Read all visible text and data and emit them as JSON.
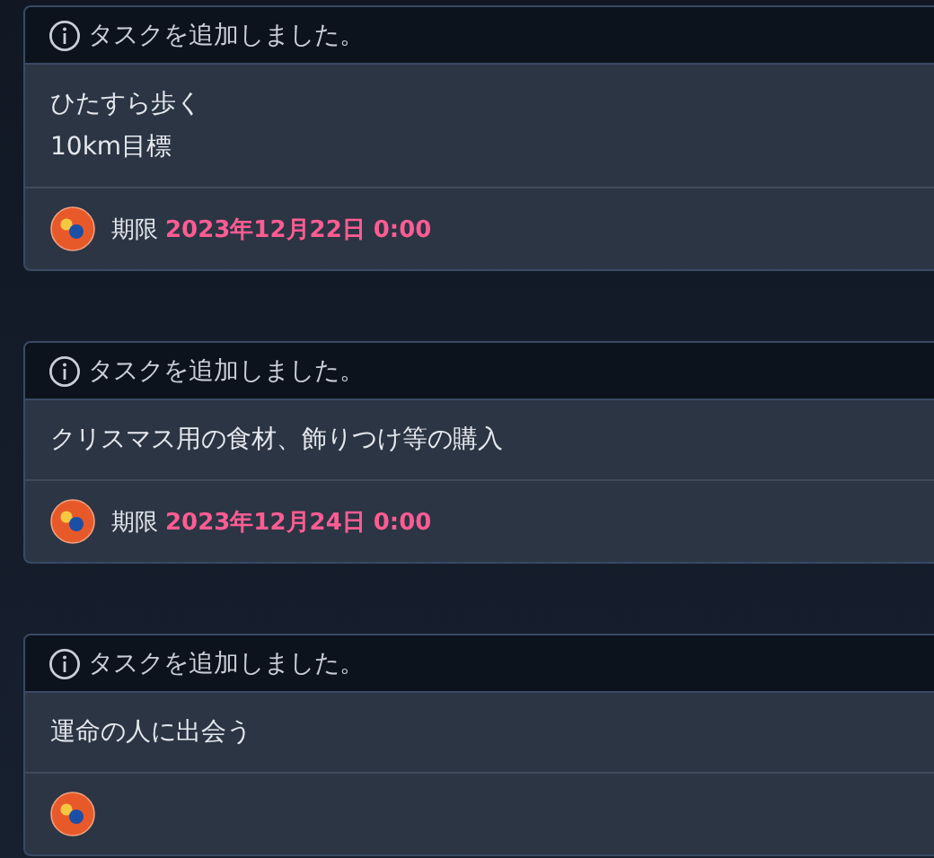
{
  "notifications": [
    {
      "header": "タスクを追加しました。",
      "lines": [
        "ひたすら歩く",
        "10km目標"
      ],
      "due_label": "期限",
      "due": "2023年12月22日 0:00"
    },
    {
      "header": "タスクを追加しました。",
      "lines": [
        "クリスマス用の食材、飾りつけ等の購入"
      ],
      "due_label": "期限",
      "due": "2023年12月24日 0:00"
    },
    {
      "header": "タスクを追加しました。",
      "lines": [
        "運命の人に出会う"
      ]
    }
  ]
}
